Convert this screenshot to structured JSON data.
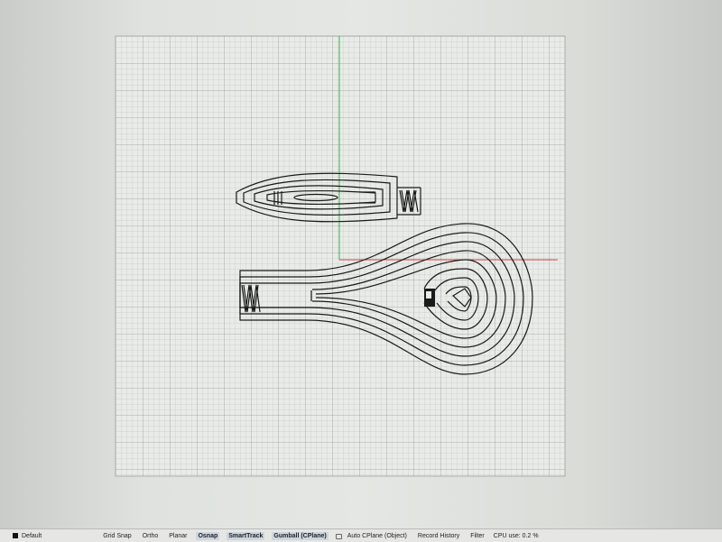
{
  "layer": {
    "name": "Default",
    "color": "#111111"
  },
  "statusbar": {
    "toggles": [
      {
        "label": "Grid Snap",
        "active": false
      },
      {
        "label": "Ortho",
        "active": false
      },
      {
        "label": "Planar",
        "active": false
      },
      {
        "label": "Osnap",
        "active": true
      },
      {
        "label": "SmartTrack",
        "active": true
      },
      {
        "label": "Gumball (CPlane)",
        "active": true
      }
    ],
    "auto_cplane": "Auto CPlane (Object)",
    "record_history": "Record History",
    "filter": "Filter",
    "cpu": "CPU use: 0.2 %"
  },
  "colors": {
    "grid_minor": "#b8bbb6",
    "grid_major": "#9ea19c",
    "x_axis": "#d63c3c",
    "y_axis": "#39b54a",
    "curves": "#1a1a1a"
  },
  "icons": [
    "lock-icon",
    "layer-color-swatch"
  ]
}
